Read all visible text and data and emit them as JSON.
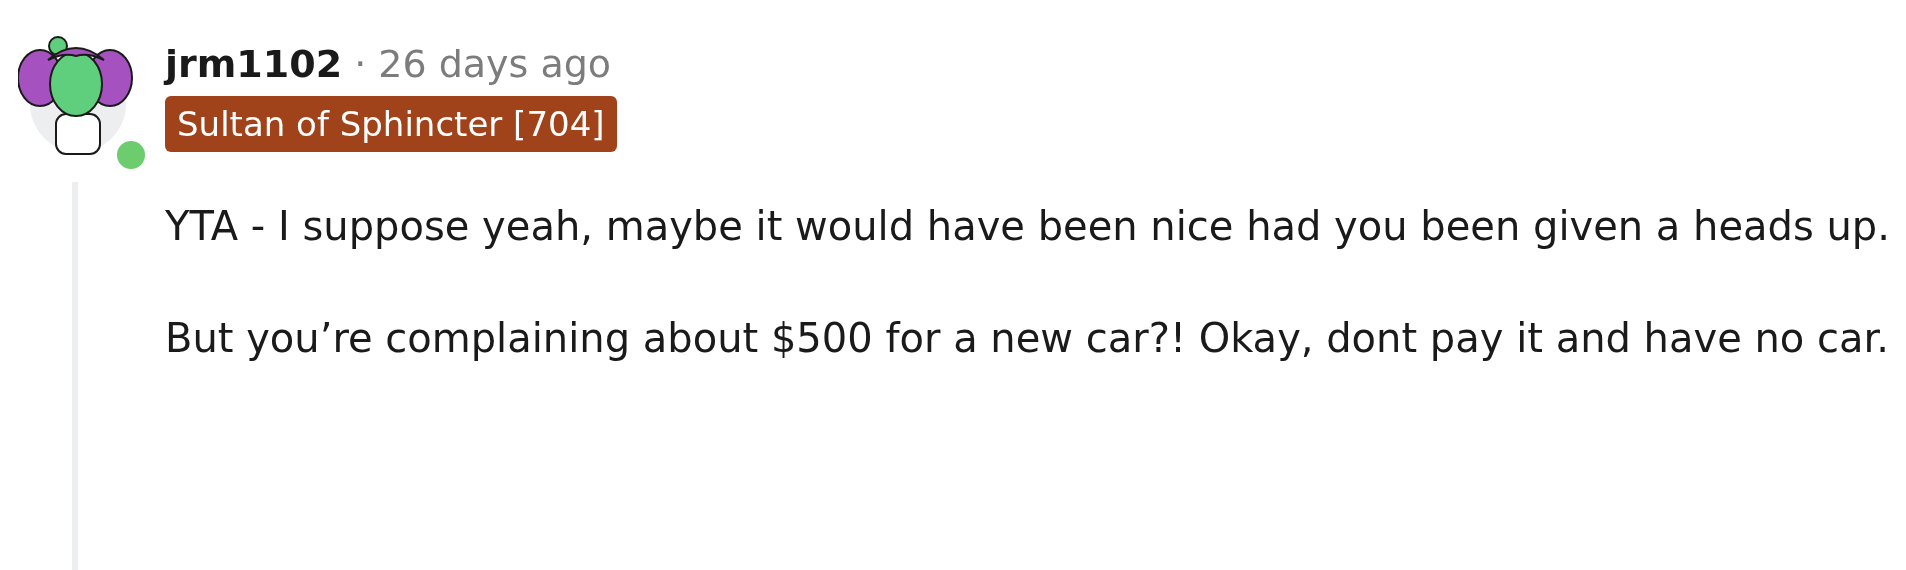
{
  "comment": {
    "author": {
      "username": "jrm1102",
      "online": true
    },
    "separator": "·",
    "time": "26 days ago",
    "flair": {
      "text": "Sultan of Sphincter [704]",
      "color": "#a0431a"
    },
    "paragraphs": [
      "YTA - I suppose yeah, maybe it would have been nice had you been given a heads up.",
      "But you’re complaining about $500 for a new car?! Okay, dont pay it and have no car."
    ]
  }
}
